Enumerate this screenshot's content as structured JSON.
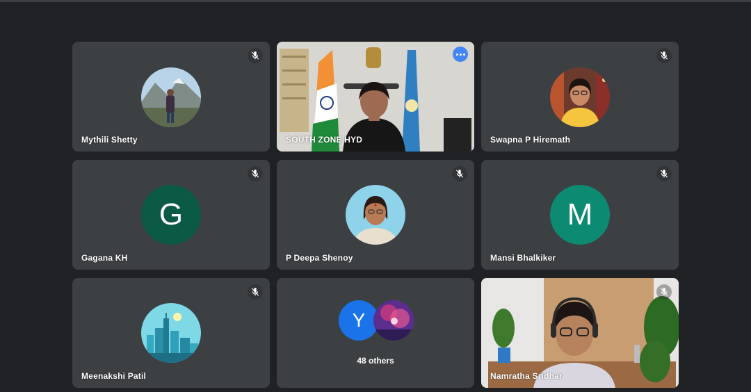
{
  "participants": [
    {
      "name": "Mythili Shetty",
      "muted": true,
      "avatar": "photo-mountains"
    },
    {
      "name": "SOUTH ZONE HYD",
      "muted": false,
      "video": true,
      "active_speaker": true
    },
    {
      "name": "Swapna P Hiremath",
      "muted": true,
      "avatar": "photo-person"
    },
    {
      "name": "Gagana KH",
      "muted": true,
      "initial": "G",
      "color": "#0b5a45"
    },
    {
      "name": "P Deepa Shenoy",
      "muted": true,
      "avatar": "photo-person"
    },
    {
      "name": "Mansi Bhalkiker",
      "muted": true,
      "initial": "M",
      "color": "#0d8a72"
    },
    {
      "name": "Meenakshi Patil",
      "muted": true,
      "avatar": "city-illustration"
    },
    {
      "name": "Namratha Sridhar",
      "muted": true,
      "video": true
    }
  ],
  "others": {
    "initial": "Y",
    "label": "48 others",
    "color": "#1a73e8"
  },
  "colors": {
    "background": "#202124",
    "tile": "#3c4043",
    "active_border": "#8ab4f8"
  }
}
